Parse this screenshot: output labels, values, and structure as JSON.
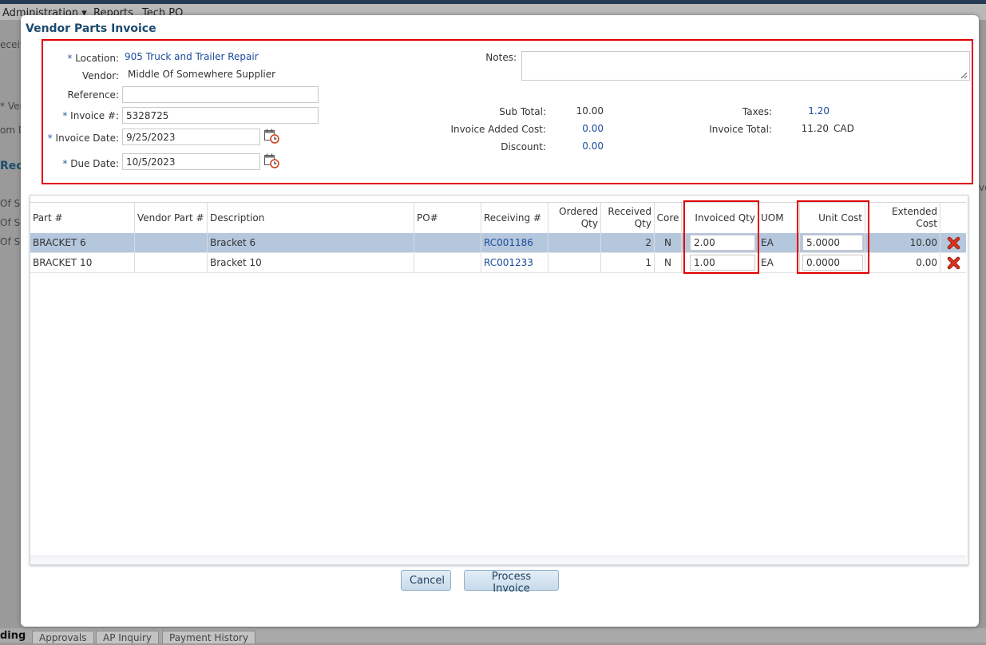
{
  "background": {
    "menu": [
      "Administration ▾",
      "Reports",
      "Tech PO"
    ],
    "left_fragments": [
      "eceiv",
      "* Ven",
      "om D",
      "Rec",
      "Of So",
      "Of So",
      "Of So"
    ],
    "right_fragment": "ve",
    "tab_active": "ding",
    "tabs": [
      "Approvals",
      "AP Inquiry",
      "Payment History"
    ]
  },
  "modal": {
    "title": "Vendor Parts Invoice",
    "form": {
      "location_label": "Location:",
      "location_value": "905 Truck and Trailer Repair",
      "vendor_label": "Vendor:",
      "vendor_value": "Middle Of Somewhere Supplier",
      "reference_label": "Reference:",
      "reference_value": "",
      "invoice_no_label": "Invoice #:",
      "invoice_no_value": "5328725",
      "invoice_date_label": "Invoice Date:",
      "invoice_date_value": "9/25/2023",
      "due_date_label": "Due Date:",
      "due_date_value": "10/5/2023",
      "notes_label": "Notes:",
      "notes_value": "",
      "required_marker": "*"
    },
    "totals": {
      "sub_total_label": "Sub Total:",
      "sub_total_value": "10.00",
      "added_cost_label": "Invoice Added Cost:",
      "added_cost_value": "0.00",
      "discount_label": "Discount:",
      "discount_value": "0.00",
      "taxes_label": "Taxes:",
      "taxes_value": "1.20",
      "invoice_total_label": "Invoice Total:",
      "invoice_total_value": "11.20",
      "currency": "CAD"
    },
    "grid": {
      "columns": {
        "part": "Part #",
        "vendor_part": "Vendor Part #",
        "description": "Description",
        "po": "PO#",
        "receiving": "Receiving #",
        "ordered_qty_1": "Ordered",
        "ordered_qty_2": "Qty",
        "received_qty_1": "Received",
        "received_qty_2": "Qty",
        "core": "Core",
        "invoiced_qty": "Invoiced Qty",
        "uom": "UOM",
        "unit_cost": "Unit Cost",
        "extended_cost": "Extended Cost"
      },
      "rows": [
        {
          "part": "BRACKET 6",
          "vendor_part": "",
          "description": "Bracket 6",
          "po": "",
          "receiving": "RC001186",
          "ordered_qty": "",
          "received_qty": "2",
          "core": "N",
          "invoiced_qty": "2.00",
          "uom": "EA",
          "unit_cost": "5.0000",
          "extended_cost": "10.00"
        },
        {
          "part": "BRACKET 10",
          "vendor_part": "",
          "description": "Bracket 10",
          "po": "",
          "receiving": "RC001233",
          "ordered_qty": "",
          "received_qty": "1",
          "core": "N",
          "invoiced_qty": "1.00",
          "uom": "EA",
          "unit_cost": "0.0000",
          "extended_cost": "0.00"
        }
      ]
    },
    "buttons": {
      "cancel": "Cancel",
      "process": "Process Invoice"
    }
  },
  "colors": {
    "title": "#1c4a6e",
    "link": "#1a4b9c",
    "highlight": "#e00000",
    "selected_row": "#b5c7dd",
    "delete_icon": "#e0301e"
  },
  "icons": {
    "calendar": "calendar-clock-icon",
    "delete": "delete-x-icon",
    "resize": "resize-grip-icon"
  }
}
